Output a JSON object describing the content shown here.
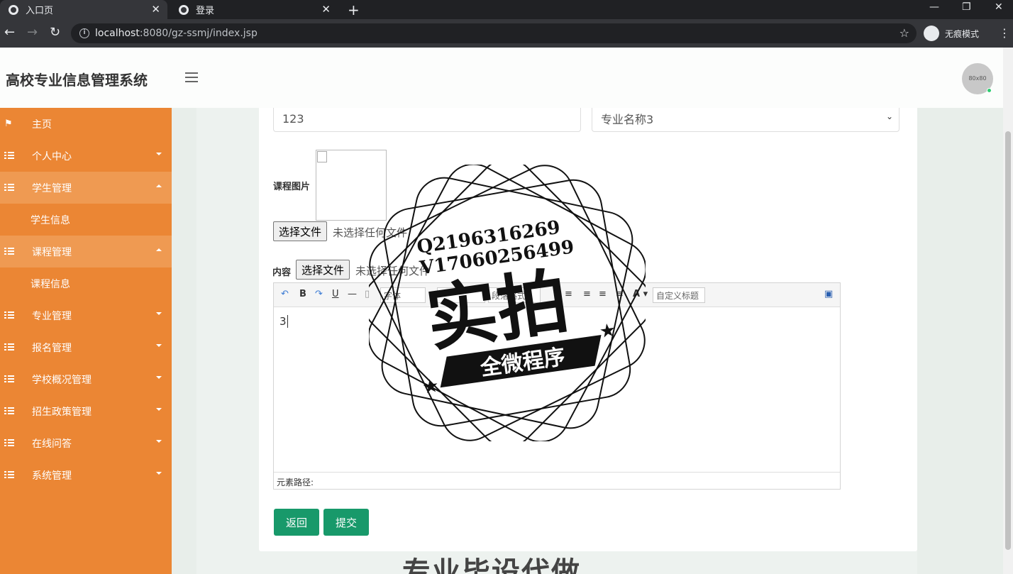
{
  "browser": {
    "tabs": [
      {
        "title": "入口页",
        "active": true
      },
      {
        "title": "登录",
        "active": false
      }
    ],
    "url_host": "localhost",
    "url_rest": ":8080/gz-ssmj/index.jsp",
    "incognito_label": "无痕模式"
  },
  "header": {
    "title": "高校专业信息管理系统",
    "avatar_text": "80x80"
  },
  "sidebar": {
    "items": [
      {
        "label": "主页",
        "icon": "flag-icon",
        "type": "top"
      },
      {
        "label": "个人中心",
        "icon": "grid-icon",
        "type": "group",
        "caret": "down"
      },
      {
        "label": "学生管理",
        "icon": "grid-icon",
        "type": "group",
        "caret": "up"
      },
      {
        "label": "学生信息",
        "type": "sub"
      },
      {
        "label": "课程管理",
        "icon": "grid-icon",
        "type": "group",
        "caret": "up"
      },
      {
        "label": "课程信息",
        "type": "sub"
      },
      {
        "label": "专业管理",
        "icon": "grid-icon",
        "type": "group",
        "caret": "down"
      },
      {
        "label": "报名管理",
        "icon": "grid-icon",
        "type": "group",
        "caret": "down"
      },
      {
        "label": "学校概况管理",
        "icon": "grid-icon",
        "type": "group",
        "caret": "down"
      },
      {
        "label": "招生政策管理",
        "icon": "grid-icon",
        "type": "group",
        "caret": "down"
      },
      {
        "label": "在线问答",
        "icon": "grid-icon",
        "type": "group",
        "caret": "down"
      },
      {
        "label": "系统管理",
        "icon": "grid-icon",
        "type": "group",
        "caret": "down"
      }
    ]
  },
  "form": {
    "field_value": "123",
    "major_select": "专业名称3",
    "image_label": "课程图片",
    "file_button": "选择文件",
    "file_none": "未选择任何文件",
    "content_label": "内容",
    "editor": {
      "font_family": "字体",
      "paragraph": "段落格式",
      "custom_title": "自定义标题",
      "body": "3",
      "status": "元素路径:"
    },
    "back_button": "返回",
    "submit_button": "提交"
  },
  "watermark": {
    "qq": "Q2196316269",
    "wx": "V17060256499",
    "main": "实拍",
    "ribbon": "全微程序"
  },
  "bottom_text": "专业毕设代做",
  "colors": {
    "sidebar": "#eb8634",
    "sidebar_open": "#ef9a52",
    "button": "#18996a"
  }
}
